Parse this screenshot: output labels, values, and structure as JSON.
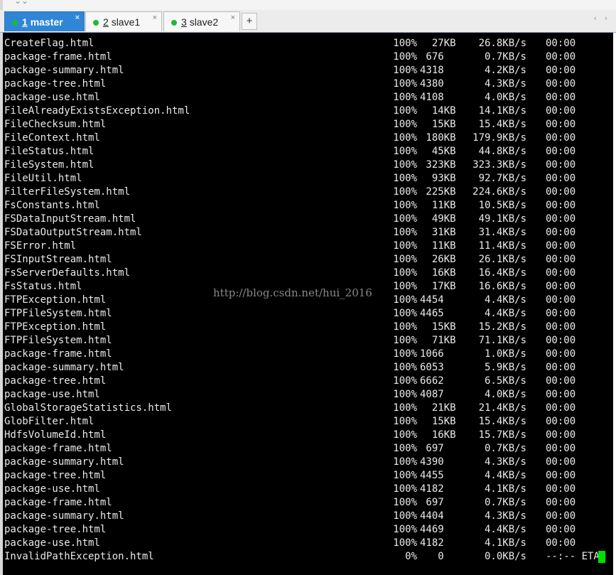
{
  "tabs": [
    {
      "num": "1",
      "name": "master",
      "close": "×"
    },
    {
      "num": "2",
      "name": "slave1",
      "close": "×"
    },
    {
      "num": "3",
      "name": "slave2",
      "close": "×"
    }
  ],
  "add_tab": "+",
  "nav": {
    "prev": "‹",
    "next": "›"
  },
  "watermark": "http://blog.csdn.net/hui_2016",
  "rows": [
    {
      "file": "CreateFlag.html",
      "pct": "100%",
      "size": "  27KB",
      "rate": "26.8KB/s",
      "eta": "00:00"
    },
    {
      "file": "package-frame.html",
      "pct": "100%",
      "size": " 676",
      "rate": "0.7KB/s",
      "eta": "00:00"
    },
    {
      "file": "package-summary.html",
      "pct": "100%",
      "size": "4318",
      "rate": "4.2KB/s",
      "eta": "00:00"
    },
    {
      "file": "package-tree.html",
      "pct": "100%",
      "size": "4380",
      "rate": "4.3KB/s",
      "eta": "00:00"
    },
    {
      "file": "package-use.html",
      "pct": "100%",
      "size": "4108",
      "rate": "4.0KB/s",
      "eta": "00:00"
    },
    {
      "file": "FileAlreadyExistsException.html",
      "pct": "100%",
      "size": "  14KB",
      "rate": "14.1KB/s",
      "eta": "00:00"
    },
    {
      "file": "FileChecksum.html",
      "pct": "100%",
      "size": "  15KB",
      "rate": "15.4KB/s",
      "eta": "00:00"
    },
    {
      "file": "FileContext.html",
      "pct": "100%",
      "size": " 180KB",
      "rate": "179.9KB/s",
      "eta": "00:00"
    },
    {
      "file": "FileStatus.html",
      "pct": "100%",
      "size": "  45KB",
      "rate": "44.8KB/s",
      "eta": "00:00"
    },
    {
      "file": "FileSystem.html",
      "pct": "100%",
      "size": " 323KB",
      "rate": "323.3KB/s",
      "eta": "00:00"
    },
    {
      "file": "FileUtil.html",
      "pct": "100%",
      "size": "  93KB",
      "rate": "92.7KB/s",
      "eta": "00:00"
    },
    {
      "file": "FilterFileSystem.html",
      "pct": "100%",
      "size": " 225KB",
      "rate": "224.6KB/s",
      "eta": "00:00"
    },
    {
      "file": "FsConstants.html",
      "pct": "100%",
      "size": "  11KB",
      "rate": "10.5KB/s",
      "eta": "00:00"
    },
    {
      "file": "FSDataInputStream.html",
      "pct": "100%",
      "size": "  49KB",
      "rate": "49.1KB/s",
      "eta": "00:00"
    },
    {
      "file": "FSDataOutputStream.html",
      "pct": "100%",
      "size": "  31KB",
      "rate": "31.4KB/s",
      "eta": "00:00"
    },
    {
      "file": "FSError.html",
      "pct": "100%",
      "size": "  11KB",
      "rate": "11.4KB/s",
      "eta": "00:00"
    },
    {
      "file": "FSInputStream.html",
      "pct": "100%",
      "size": "  26KB",
      "rate": "26.1KB/s",
      "eta": "00:00"
    },
    {
      "file": "FsServerDefaults.html",
      "pct": "100%",
      "size": "  16KB",
      "rate": "16.4KB/s",
      "eta": "00:00"
    },
    {
      "file": "FsStatus.html",
      "pct": "100%",
      "size": "  17KB",
      "rate": "16.6KB/s",
      "eta": "00:00"
    },
    {
      "file": "FTPException.html",
      "pct": "100%",
      "size": "4454",
      "rate": "4.4KB/s",
      "eta": "00:00"
    },
    {
      "file": "FTPFileSystem.html",
      "pct": "100%",
      "size": "4465",
      "rate": "4.4KB/s",
      "eta": "00:00"
    },
    {
      "file": "FTPException.html",
      "pct": "100%",
      "size": "  15KB",
      "rate": "15.2KB/s",
      "eta": "00:00"
    },
    {
      "file": "FTPFileSystem.html",
      "pct": "100%",
      "size": "  71KB",
      "rate": "71.1KB/s",
      "eta": "00:00"
    },
    {
      "file": "package-frame.html",
      "pct": "100%",
      "size": "1066",
      "rate": "1.0KB/s",
      "eta": "00:00"
    },
    {
      "file": "package-summary.html",
      "pct": "100%",
      "size": "6053",
      "rate": "5.9KB/s",
      "eta": "00:00"
    },
    {
      "file": "package-tree.html",
      "pct": "100%",
      "size": "6662",
      "rate": "6.5KB/s",
      "eta": "00:00"
    },
    {
      "file": "package-use.html",
      "pct": "100%",
      "size": "4087",
      "rate": "4.0KB/s",
      "eta": "00:00"
    },
    {
      "file": "GlobalStorageStatistics.html",
      "pct": "100%",
      "size": "  21KB",
      "rate": "21.4KB/s",
      "eta": "00:00"
    },
    {
      "file": "GlobFilter.html",
      "pct": "100%",
      "size": "  15KB",
      "rate": "15.4KB/s",
      "eta": "00:00"
    },
    {
      "file": "HdfsVolumeId.html",
      "pct": "100%",
      "size": "  16KB",
      "rate": "15.7KB/s",
      "eta": "00:00"
    },
    {
      "file": "package-frame.html",
      "pct": "100%",
      "size": " 697",
      "rate": "0.7KB/s",
      "eta": "00:00"
    },
    {
      "file": "package-summary.html",
      "pct": "100%",
      "size": "4390",
      "rate": "4.3KB/s",
      "eta": "00:00"
    },
    {
      "file": "package-tree.html",
      "pct": "100%",
      "size": "4455",
      "rate": "4.4KB/s",
      "eta": "00:00"
    },
    {
      "file": "package-use.html",
      "pct": "100%",
      "size": "4182",
      "rate": "4.1KB/s",
      "eta": "00:00"
    },
    {
      "file": "package-frame.html",
      "pct": "100%",
      "size": " 697",
      "rate": "0.7KB/s",
      "eta": "00:00"
    },
    {
      "file": "package-summary.html",
      "pct": "100%",
      "size": "4404",
      "rate": "4.3KB/s",
      "eta": "00:00"
    },
    {
      "file": "package-tree.html",
      "pct": "100%",
      "size": "4469",
      "rate": "4.4KB/s",
      "eta": "00:00"
    },
    {
      "file": "package-use.html",
      "pct": "100%",
      "size": "4182",
      "rate": "4.1KB/s",
      "eta": "00:00"
    },
    {
      "file": "InvalidPathException.html",
      "pct": "0%",
      "size": "   0",
      "rate": "0.0KB/s",
      "eta": "--:-- ETA"
    }
  ]
}
